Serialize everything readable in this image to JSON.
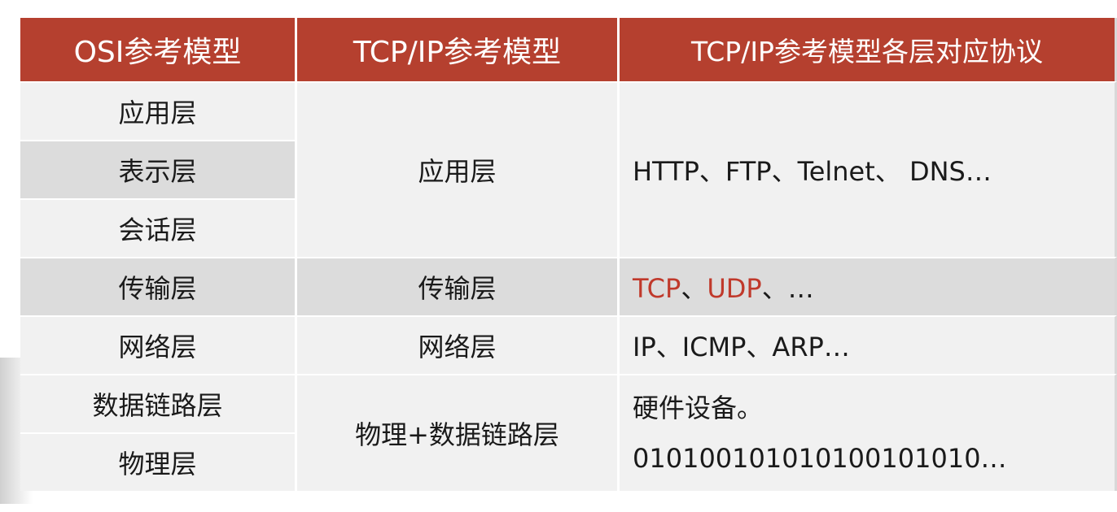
{
  "header": {
    "osi": "OSI参考模型",
    "tcpip": "TCP/IP参考模型",
    "protocols": "TCP/IP参考模型各层对应协议"
  },
  "osi_layers": [
    "应用层",
    "表示层",
    "会话层",
    "传输层",
    "网络层",
    "数据链路层",
    "物理层"
  ],
  "tcpip_layers": {
    "application": "应用层",
    "transport": "传输层",
    "network": "网络层",
    "physical_datalink": "物理+数据链路层"
  },
  "protocols": {
    "application": "HTTP、FTP、Telnet、 DNS…",
    "transport_tcp": "TCP",
    "transport_sep1": "、",
    "transport_udp": "UDP",
    "transport_rest": "、…",
    "network": "IP、ICMP、ARP…",
    "physical_line1": "硬件设备。",
    "physical_line2": "010100101010100101010…"
  },
  "colors": {
    "header_bg": "#b5402f",
    "highlight_red": "#c0392b"
  }
}
